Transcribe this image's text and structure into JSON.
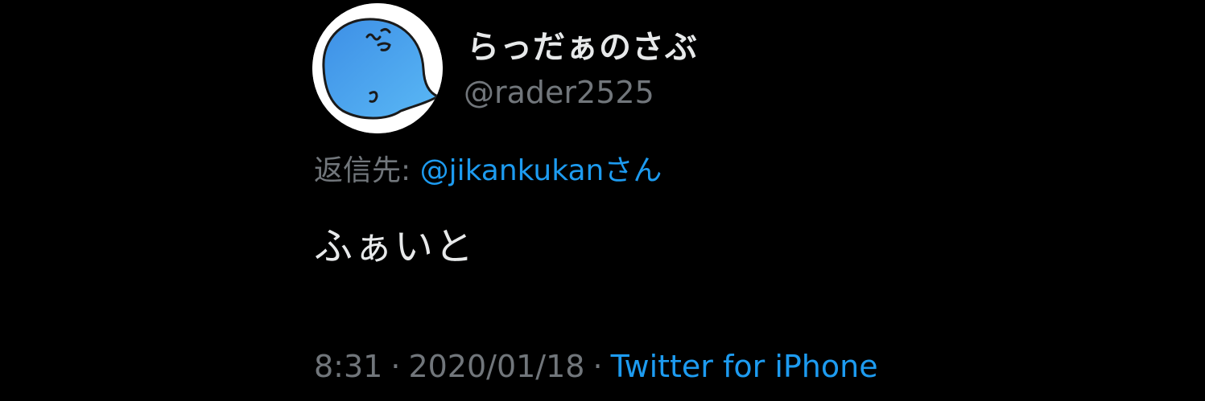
{
  "author": {
    "display_name": "らっだぁのさぶ",
    "handle": "@rader2525",
    "avatar_icon": "blue-whale-mascot-icon"
  },
  "reply": {
    "label": "返信先: ",
    "mention": "@jikankukanさん"
  },
  "tweet": {
    "text": "ふぁいと"
  },
  "meta": {
    "time": "8:31",
    "separator": "·",
    "date": "2020/01/18",
    "source": "Twitter for iPhone"
  },
  "colors": {
    "background": "#000000",
    "primary_text": "#e7e9ea",
    "secondary_text": "#71767b",
    "link": "#1d9bf0"
  }
}
